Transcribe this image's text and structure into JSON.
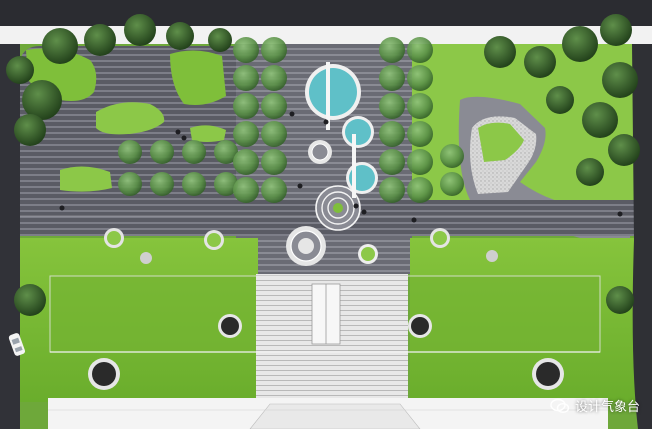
{
  "watermark": {
    "text": "设计气象台",
    "icon": "wechat-icon"
  },
  "colors": {
    "lawn": "#7fbf3a",
    "lawn_light": "#9bd04f",
    "paving_dark": "#4a4b55",
    "paving_light": "#8e8f98",
    "tree": "#3f7a2e",
    "water": "#5fc0c8",
    "road": "#34353b",
    "white": "#f4f4f4"
  }
}
